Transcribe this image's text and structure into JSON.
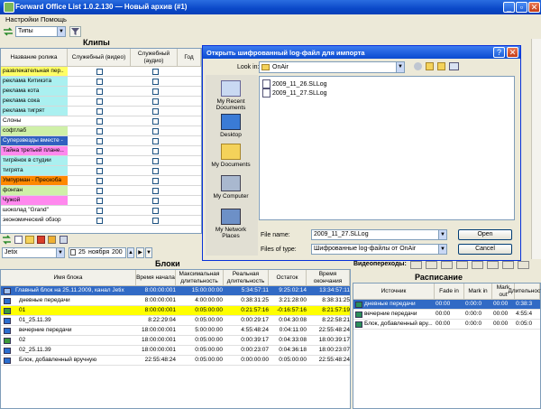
{
  "window": {
    "title": "Forward Office List 1.0.2.130 — Новый архив (#1)"
  },
  "menu": [
    "Настройки",
    "Помощь"
  ],
  "toolbar": {
    "types_combo": "Типы"
  },
  "clips_panel": {
    "title": "Клипы",
    "columns": [
      "Название ролика",
      "Служебный (видео)",
      "Служебный (аудио)",
      "Год"
    ],
    "rows": [
      {
        "name": "развлекательная пер...",
        "color": "#ffff66"
      },
      {
        "name": "реклама Китикэта",
        "color": "#aaf0f0"
      },
      {
        "name": "реклама кота",
        "color": "#aaf0f0"
      },
      {
        "name": "реклама сока",
        "color": "#aaf0f0"
      },
      {
        "name": "реклама тигрят",
        "color": "#aaf0f0"
      },
      {
        "name": "Слоны",
        "color": "#ffffff"
      },
      {
        "name": "софтлаб",
        "color": "#cff0a8"
      },
      {
        "name": "Суперзвезды вместе - 1",
        "color": "#3060c0"
      },
      {
        "name": "Тайна третьей плане...",
        "color": "#ff88ee"
      },
      {
        "name": "тигрёнок в студии",
        "color": "#aaf0f0"
      },
      {
        "name": "тигрята",
        "color": "#aaf0f0"
      },
      {
        "name": "Умпурман - Прескоба",
        "color": "#ff8800"
      },
      {
        "name": "фонган",
        "color": "#cff0a8"
      },
      {
        "name": "Чужой",
        "color": "#ff88ee"
      },
      {
        "name": "шоколад \"Grand\"",
        "color": "#ffffff"
      },
      {
        "name": "экономический обзор",
        "color": "#ffffff"
      }
    ]
  },
  "date_bar": {
    "channel": "Jetix",
    "day": "25",
    "month": "ноября",
    "year": "200"
  },
  "blocks_panel": {
    "title": "Блоки",
    "columns": [
      "Имя блока",
      "Время начала",
      "Максимальная длительность",
      "Реальная длительность",
      "Остаток",
      "Время окончания"
    ],
    "rows": [
      {
        "name": "Главный блок на 25.11.2009, канал Jetix",
        "start": "8:00:00:001",
        "max": "15:00:00:00",
        "real": "5:34:57:11",
        "rest": "9:25:02:14",
        "end": "13:34:57:11",
        "style": "selected"
      },
      {
        "name": "дневные передачи",
        "start": "8:00:00:001",
        "max": "4:00:00:00",
        "real": "0:38:31:25",
        "rest": "3:21:28:00",
        "end": "8:38:31:25",
        "style": "white"
      },
      {
        "name": "01",
        "start": "8:00:00:001",
        "max": "0:05:00:00",
        "real": "0:21:57:16",
        "rest": "-0:16:57:16",
        "end": "8:21:57:19",
        "style": "yellow"
      },
      {
        "name": "01_25.11.39",
        "start": "8:22:29:04",
        "max": "0:05:00:00",
        "real": "0:00:29:17",
        "rest": "0:04:30:08",
        "end": "8:22:58:21",
        "style": "white"
      },
      {
        "name": "вечерние передачи",
        "start": "18:00:00:001",
        "max": "5:00:00:00",
        "real": "4:55:48:24",
        "rest": "0:04:11:00",
        "end": "22:55:48:24",
        "style": "white"
      },
      {
        "name": "02",
        "start": "18:00:00:001",
        "max": "0:05:00:00",
        "real": "0:00:39:17",
        "rest": "0:04:33:08",
        "end": "18:00:39:17",
        "style": "white"
      },
      {
        "name": "02_25.11.39",
        "start": "18:00:00:001",
        "max": "0:05:00:00",
        "real": "0:00:23:07",
        "rest": "0:04:36:18",
        "end": "18:00:23:07",
        "style": "white"
      },
      {
        "name": "Блок, добавленный вручную",
        "start": "22:55:48:24",
        "max": "0:05:00:00",
        "real": "0:00:00:00",
        "rest": "0:05:00:00",
        "end": "22:55:48:24",
        "style": "white"
      }
    ]
  },
  "schedule_panel": {
    "transitions_label": "Видеопереходы:",
    "title": "Расписание",
    "columns": [
      "Источник",
      "Fade in",
      "Mark in",
      "Mark out",
      "Длительность"
    ],
    "rows": [
      {
        "name": "дневные передачи",
        "fade": "00:00",
        "markin": "0:00:0",
        "markout": "00:00",
        "dur": "0:38:3",
        "style": "selected"
      },
      {
        "name": "вечерние передачи",
        "fade": "00:00",
        "markin": "0:00:0",
        "markout": "00:00",
        "dur": "4:55:4",
        "style": "white"
      },
      {
        "name": "Блок, добавленный вру...",
        "fade": "00:00",
        "markin": "0:00:0",
        "markout": "00:00",
        "dur": "0:05:0",
        "style": "white"
      }
    ]
  },
  "dialog": {
    "title": "Открыть шифрованный log-файл для импорта",
    "look_in_label": "Look in:",
    "look_in_value": "OnAir",
    "files": [
      "2009_11_26.SLLog",
      "2009_11_27.SLLog"
    ],
    "places": [
      "My Recent Documents",
      "Desktop",
      "My Documents",
      "My Computer",
      "My Network Places"
    ],
    "file_name_label": "File name:",
    "file_name_value": "2009_11_27.SLLog",
    "file_type_label": "Files of type:",
    "file_type_value": "Шифрованные log-файлы от OnAir",
    "open_button": "Open",
    "cancel_button": "Cancel",
    "help_button": "?",
    "close_button": "✕"
  },
  "colors": {
    "xp_blue": "#0a48c8",
    "selection_blue": "#316ac5",
    "highlight_yellow": "#ffff00"
  }
}
